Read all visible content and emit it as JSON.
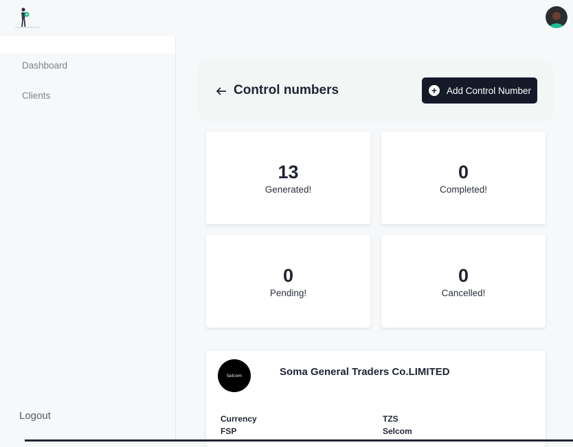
{
  "sidebar": {
    "items": [
      {
        "label": "Dashboard"
      },
      {
        "label": "Clients"
      }
    ],
    "logout_label": "Logout"
  },
  "header": {
    "title": "Control numbers",
    "add_button_label": "Add Control Number"
  },
  "stats": [
    {
      "value": "13",
      "label": "Generated!"
    },
    {
      "value": "0",
      "label": "Completed!"
    },
    {
      "value": "0",
      "label": "Pending!"
    },
    {
      "value": "0",
      "label": "Cancelled!"
    }
  ],
  "client": {
    "logo_text": "Selcom",
    "name": "Soma General Traders Co.LIMITED",
    "details": [
      {
        "label": "Currency",
        "value": "TZS"
      },
      {
        "label": "FSP",
        "value": "Selcom"
      }
    ]
  },
  "colors": {
    "primary_dark": "#141a27",
    "header_panel": "#f2f7f5",
    "avatar_accent": "#1fbf94"
  }
}
